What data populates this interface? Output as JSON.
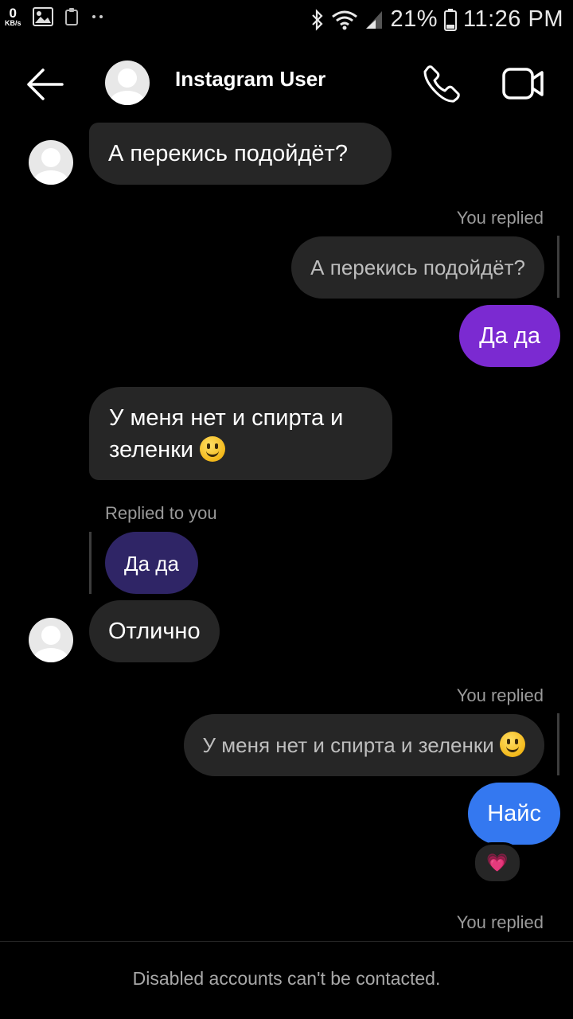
{
  "status_bar": {
    "kbs_value": "0",
    "kbs_unit": "KB/s",
    "battery": "21%",
    "time": "11:26 PM"
  },
  "header": {
    "title": "Instagram User"
  },
  "messages": {
    "m1": {
      "text": "А перекись подойдёт?"
    },
    "m2": {
      "meta": "You replied",
      "quote": "А перекись подойдёт?",
      "text": "Да да"
    },
    "m3": {
      "line1": "У меня нет и спирта и",
      "line2": "зеленки"
    },
    "m4": {
      "meta": "Replied to you",
      "quote": "Да да",
      "text": "Отлично"
    },
    "m5": {
      "meta": "You replied",
      "quote": "У меня нет и спирта и зеленки",
      "text": "Найс",
      "reaction": "💗"
    },
    "m6": {
      "meta": "You replied"
    }
  },
  "footer": {
    "notice": "Disabled accounts can't be contacted."
  },
  "colors": {
    "background": "#000000",
    "incoming_bubble": "#262626",
    "outgoing_purple": "#7b2ad1",
    "outgoing_blue": "#3478f0",
    "quote_dark": "#2f2566"
  },
  "icons": [
    "back-arrow-icon",
    "call-icon",
    "video-icon",
    "avatar-placeholder-icon",
    "image-icon",
    "clipboard-icon",
    "bluetooth-icon",
    "wifi-icon",
    "signal-icon",
    "battery-icon"
  ]
}
